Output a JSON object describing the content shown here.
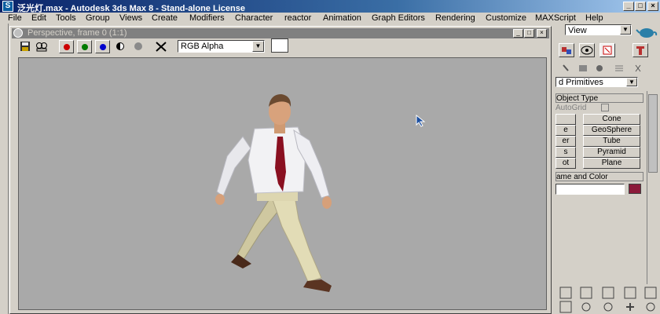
{
  "window": {
    "title": "泛光灯.max - Autodesk 3ds Max 8  - Stand-alone License",
    "icon": "3ds-max-icon",
    "controls": {
      "minimize": "_",
      "maximize": "□",
      "close": "×"
    }
  },
  "menubar": {
    "items": [
      "File",
      "Edit",
      "Tools",
      "Group",
      "Views",
      "Create",
      "Modifiers",
      "Character",
      "reactor",
      "Animation",
      "Graph Editors",
      "Rendering",
      "Customize",
      "MAXScript",
      "Help"
    ]
  },
  "render_frame": {
    "title": "Perspective, frame 0 (1:1)",
    "toolbar": {
      "channel_select": "RGB Alpha",
      "channel_colors": {
        "red": "#cc0000",
        "green": "#007a00",
        "blue": "#0000cc"
      }
    },
    "viewport_background": "#a9a9a9"
  },
  "command_panel": {
    "view_select": "View",
    "category_select": "d Primitives",
    "object_type_header": "Object Type",
    "autogrid_label": "AutoGrid",
    "buttons_left": [
      "",
      "e",
      "er",
      "s",
      "ot"
    ],
    "buttons_right": [
      "Cone",
      "GeoSphere",
      "Tube",
      "Pyramid",
      "Plane"
    ],
    "name_color_header": "ame and Color",
    "object_color": "#8b1a3a"
  }
}
